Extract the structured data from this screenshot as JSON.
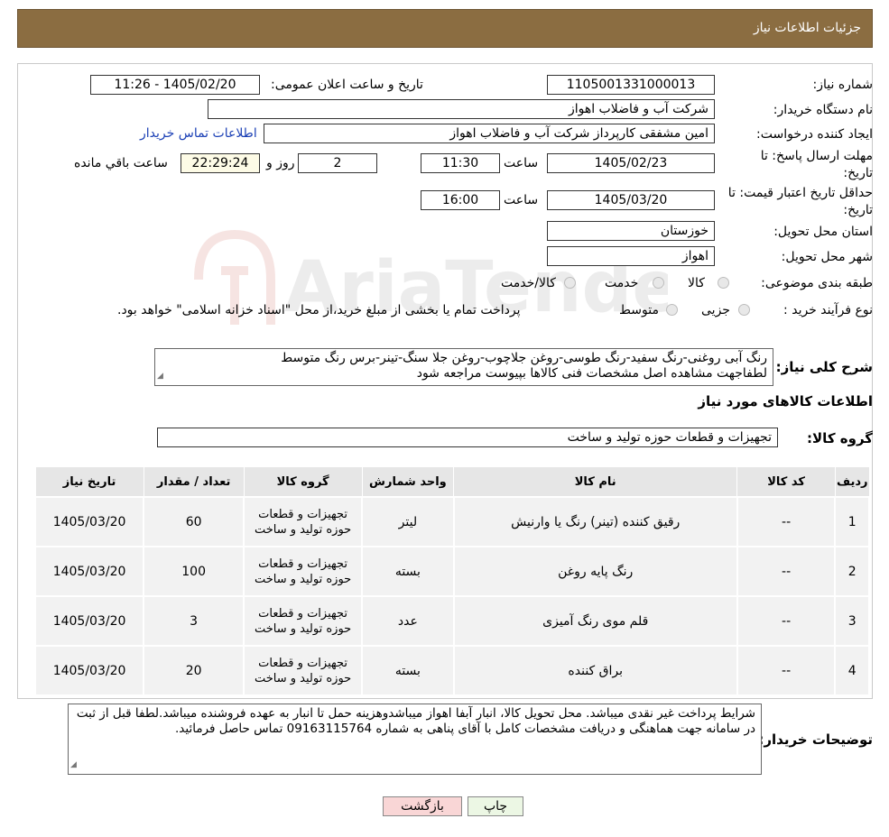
{
  "header": {
    "title": "جزئیات اطلاعات نیاز"
  },
  "form": {
    "need_number_label": "شماره نیاز:",
    "need_number": "1105001331000013",
    "announce_label": "تاریخ و ساعت اعلان عمومی:",
    "announce_value": "1405/02/20 - 11:26",
    "buyer_org_label": "نام دستگاه خریدار:",
    "buyer_org": "شرکت آب و فاضلاب اهواز",
    "creator_label": "ایجاد کننده درخواست:",
    "creator": "امین مشفقی کارپرداز شرکت آب و فاضلاب اهواز",
    "contact_link": "اطلاعات تماس خریدار",
    "deadline_label_1": "مهلت ارسال پاسخ: تا",
    "deadline_label_2": "تاریخ:",
    "deadline_date": "1405/02/23",
    "time_label": "ساعت",
    "deadline_time": "11:30",
    "days_value": "2",
    "days_label": "روز و",
    "remaining_time": "22:29:24",
    "remaining_label": "ساعت باقي مانده",
    "validity_label_1": "حداقل تاریخ اعتبار قیمت: تا",
    "validity_label_2": "تاریخ:",
    "validity_date": "1405/03/20",
    "validity_time": "16:00",
    "province_label": "استان محل تحویل:",
    "province": "خوزستان",
    "city_label": "شهر محل تحویل:",
    "city": "اهواز",
    "category_label": "طبقه بندی موضوعی:",
    "category_options": [
      "کالا",
      "خدمت",
      "کالا/خدمت"
    ],
    "purchase_type_label": "نوع فرآیند خرید :",
    "purchase_options": [
      "جزیی",
      "متوسط"
    ],
    "purchase_note": "پرداخت تمام یا بخشی از مبلغ خرید،از محل \"اسناد خزانه اسلامی\" خواهد بود."
  },
  "description": {
    "label": "شرح کلی نیاز:",
    "line1": "رنگ آبی روغنی-رنگ سفید-رنگ طوسی-روغن جلاچوب-روغن جلا سنگ-تینر-برس رنگ متوسط",
    "line2": "لطفاجهت مشاهده اصل مشخصات فنی کالاها بپیوست مراجعه شود"
  },
  "items_section": {
    "title": "اطلاعات کالاهای مورد نیاز",
    "group_label": "گروه کالا:",
    "group_value": "تجهیزات و قطعات حوزه تولید و ساخت",
    "columns": [
      "ردیف",
      "کد کالا",
      "نام کالا",
      "واحد شمارش",
      "گروه کالا",
      "تعداد / مقدار",
      "تاریخ نیاز"
    ],
    "rows": [
      {
        "row": "1",
        "code": "--",
        "name": "رقیق کننده (تینر) رنگ یا وارنیش",
        "unit": "لیتر",
        "group": "تجهیزات و قطعات حوزه تولید و ساخت",
        "qty": "60",
        "date": "1405/03/20"
      },
      {
        "row": "2",
        "code": "--",
        "name": "رنگ پایه روغن",
        "unit": "بسته",
        "group": "تجهیزات و قطعات حوزه تولید و ساخت",
        "qty": "100",
        "date": "1405/03/20"
      },
      {
        "row": "3",
        "code": "--",
        "name": "قلم موی رنگ آمیزی",
        "unit": "عدد",
        "group": "تجهیزات و قطعات حوزه تولید و ساخت",
        "qty": "3",
        "date": "1405/03/20"
      },
      {
        "row": "4",
        "code": "--",
        "name": "براق کننده",
        "unit": "بسته",
        "group": "تجهیزات و قطعات حوزه تولید و ساخت",
        "qty": "20",
        "date": "1405/03/20"
      }
    ]
  },
  "buyer_notes": {
    "label": "توضیحات خریدار:",
    "text": "شرایط پرداخت غیر نقدی میباشد. محل تحویل کالا، انبار آبفا اهواز میباشدوهزینه حمل تا انبار به عهده فروشنده میباشد.لطفا قبل از ثبت در سامانه جهت هماهنگی و دریافت مشخصات کامل با آقای  پناهی به شماره 09163115764 تماس حاصل فرمائید."
  },
  "buttons": {
    "print": "چاپ",
    "back": "بازگشت"
  },
  "watermark": "AriaTender.neT",
  "colors": {
    "header": "#8b6d41",
    "back_button": "#f9d6d6",
    "print_button": "#ecf7e4"
  }
}
